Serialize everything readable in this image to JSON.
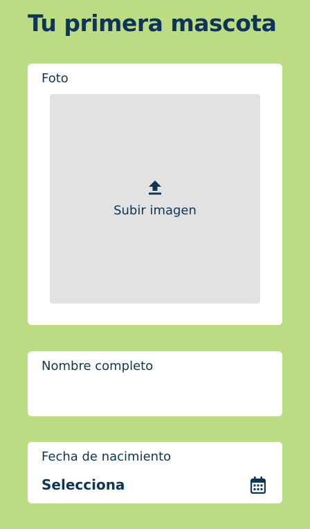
{
  "page": {
    "title": "Tu primera mascota"
  },
  "photo": {
    "label": "Foto",
    "upload_label": "Subir imagen",
    "icon": "upload-icon"
  },
  "name": {
    "label": "Nombre completo",
    "value": "",
    "placeholder": ""
  },
  "birthdate": {
    "label": "Fecha de nacimiento",
    "value": "Selecciona",
    "icon": "calendar-icon"
  },
  "colors": {
    "background": "#bcdc84",
    "card": "#ffffff",
    "text": "#0f3556",
    "upload_area": "#e2e2e2"
  }
}
